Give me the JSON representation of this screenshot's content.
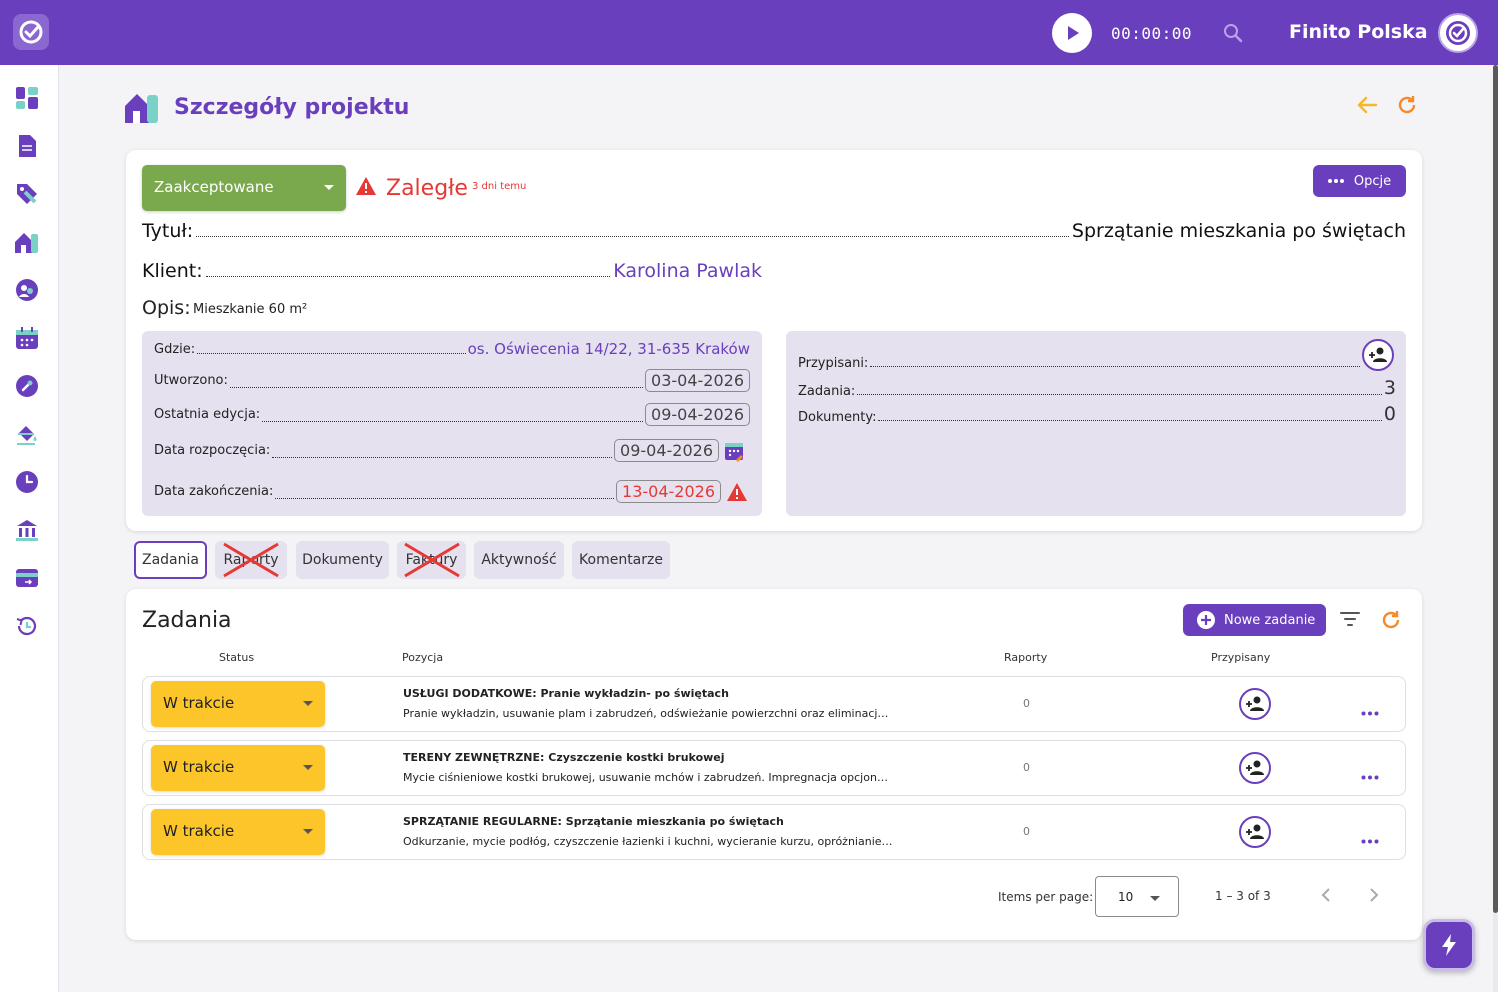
{
  "topbar": {
    "timer": "00:00:00",
    "company": "Finito Polska"
  },
  "sidebar": {
    "items": [
      "dashboard-icon",
      "document-icon",
      "tag-icon",
      "projects-icon",
      "clients-icon",
      "calendar-icon",
      "tools-icon",
      "paint-icon",
      "clock-icon",
      "bank-icon",
      "card-icon",
      "history-icon"
    ]
  },
  "page": {
    "title": "Szczegóły projektu"
  },
  "project": {
    "status": "Zaakceptowane",
    "overdue": "Zaległe",
    "overdue_ago": "3 dni temu",
    "options_label": "Opcje",
    "title_label": "Tytuł:",
    "title_value": "Sprzątanie mieszkania po świętach",
    "client_label": "Klient:",
    "client_value": "Karolina Pawlak",
    "desc_label": "Opis:",
    "desc_value": "Mieszkanie 60 m²",
    "where_label": "Gdzie:",
    "where_value": "os. Oświecenia 14/22, 31-635 Kraków",
    "created_label": "Utworzono:",
    "created_value": "03-04-2026",
    "edited_label": "Ostatnia edycja:",
    "edited_value": "09-04-2026",
    "start_label": "Data rozpoczęcia:",
    "start_value": "09-04-2026",
    "end_label": "Data zakończenia:",
    "end_value": "13-04-2026",
    "assigned_label": "Przypisani:",
    "tasks_label": "Zadania:",
    "tasks_value": "3",
    "docs_label": "Dokumenty:",
    "docs_value": "0"
  },
  "tabs": [
    {
      "label": "Zadania"
    },
    {
      "label": "Raporty"
    },
    {
      "label": "Dokumenty"
    },
    {
      "label": "Faktury"
    },
    {
      "label": "Aktywność"
    },
    {
      "label": "Komentarze"
    }
  ],
  "tasks": {
    "title": "Zadania",
    "new_label": "Nowe zadanie",
    "headers": {
      "status": "Status",
      "position": "Pozycja",
      "reports": "Raporty",
      "assigned": "Przypisany"
    },
    "rows": [
      {
        "status": "W trakcie",
        "title": "USŁUGI DODATKOWE: Pranie wykładzin- po świętach",
        "desc": "Pranie wykładzin, usuwanie plam i zabrudzeń, odświeżanie powierzchni oraz eliminacja...",
        "reports": "0"
      },
      {
        "status": "W trakcie",
        "title": "TERENY ZEWNĘTRZNE: Czyszczenie kostki brukowej",
        "desc": "Mycie ciśnieniowe kostki brukowej, usuwanie mchów i zabrudzeń. Impregnacja opcjonal...",
        "reports": "0"
      },
      {
        "status": "W trakcie",
        "title": "SPRZĄTANIE REGULARNE: Sprzątanie mieszkania po świętach",
        "desc": "Odkurzanie, mycie podłóg, czyszczenie łazienki i kuchni, wycieranie kurzu, opróżnianie ...",
        "reports": "0"
      }
    ],
    "pager": {
      "label": "Items per page:",
      "size": "10",
      "range": "1 – 3 of 3"
    }
  },
  "colors": {
    "brand": "#6a3fbd",
    "accepted": "#7aa84c",
    "in_progress": "#fcc52a",
    "danger": "#e53935",
    "accent_orange": "#f58a2a"
  }
}
